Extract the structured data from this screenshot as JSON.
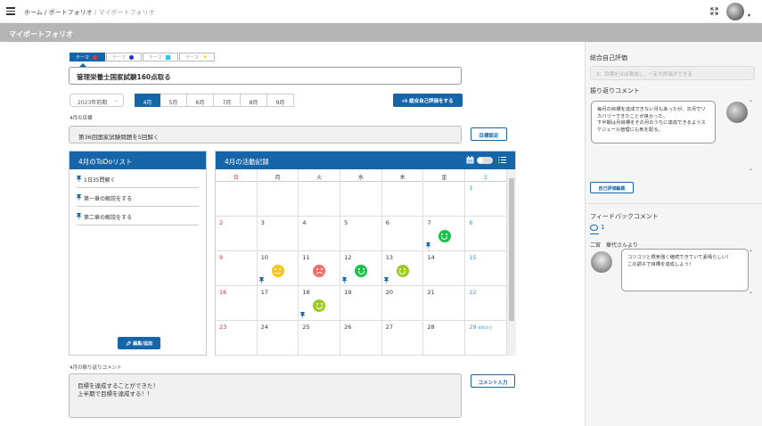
{
  "breadcrumb": {
    "home": "ホーム",
    "sep1": "/",
    "portfolio": "ポートフォリオ",
    "sep2": "/",
    "current": "マイポートフォリオ"
  },
  "page_title": "マイポートフォリオ",
  "theme_tabs": [
    {
      "label": "テーマ",
      "color": "#e53935",
      "active": true
    },
    {
      "label": "テーマ",
      "color": "#1e2fd6",
      "active": false
    },
    {
      "label": "テーマ",
      "color": "#26c6da",
      "active": false
    },
    {
      "label": "テーマ",
      "color": "#fdd835",
      "active": false
    }
  ],
  "theme_title": "管理栄養士国家試験160点取る",
  "term_select": "2023年前期",
  "months": [
    "4月",
    "5月",
    "6月",
    "7月",
    "8月",
    "9月"
  ],
  "self_eval_button": "総合自己評価をする",
  "goal_label": "4月の目標",
  "goal_text": "第36回国家試験問題を5回解く",
  "goal_set_button": "目標設定",
  "todo": {
    "title": "4月のToDoリスト",
    "items": [
      "1日35問解く",
      "第一章の解説をする",
      "第二章の解説をする"
    ],
    "add_button": "編集/追加"
  },
  "calendar": {
    "title": "4月の活動記録",
    "weekdays": [
      "日",
      "月",
      "火",
      "水",
      "木",
      "金",
      "土"
    ],
    "rows": [
      [
        "",
        "",
        "",
        "",
        "",
        "",
        "1"
      ],
      [
        "2",
        "3",
        "4",
        "5",
        "6",
        "7",
        "8"
      ],
      [
        "9",
        "10",
        "11",
        "12",
        "13",
        "14",
        "15"
      ],
      [
        "16",
        "17",
        "18",
        "19",
        "20",
        "21",
        "22"
      ],
      [
        "23",
        "24",
        "25",
        "26",
        "27",
        "28",
        "29"
      ]
    ],
    "holiday_note": "昭和の日"
  },
  "comment_label": "4月の振り返りコメント",
  "comment_text": "目標を達成することができた！\n上半期で目標を達成する！！",
  "comment_button": "コメント入力",
  "right_panel": {
    "self_eval_label": "総合自己評価",
    "self_eval_placeholder": "3：目標をほぼ達成し、一定の評価ができる",
    "reflection_label": "振り返りコメント",
    "reflection_text": "毎月の目標を達成できない月もあったが、次月でリカバリーできたことが良かった。\n下半期は月目標をその月のうちに達成できるようスケジュール管理にも気を配る。",
    "reflection_edit_button": "自己評価編集",
    "feedback_label": "フィードバックコメント",
    "feedback_count": "1",
    "feedback_author": "二宮　華代さんより",
    "feedback_text": "コツコツと根気強く継続できていて素晴らしい！\nこの調子で目標を達成しよう！"
  }
}
